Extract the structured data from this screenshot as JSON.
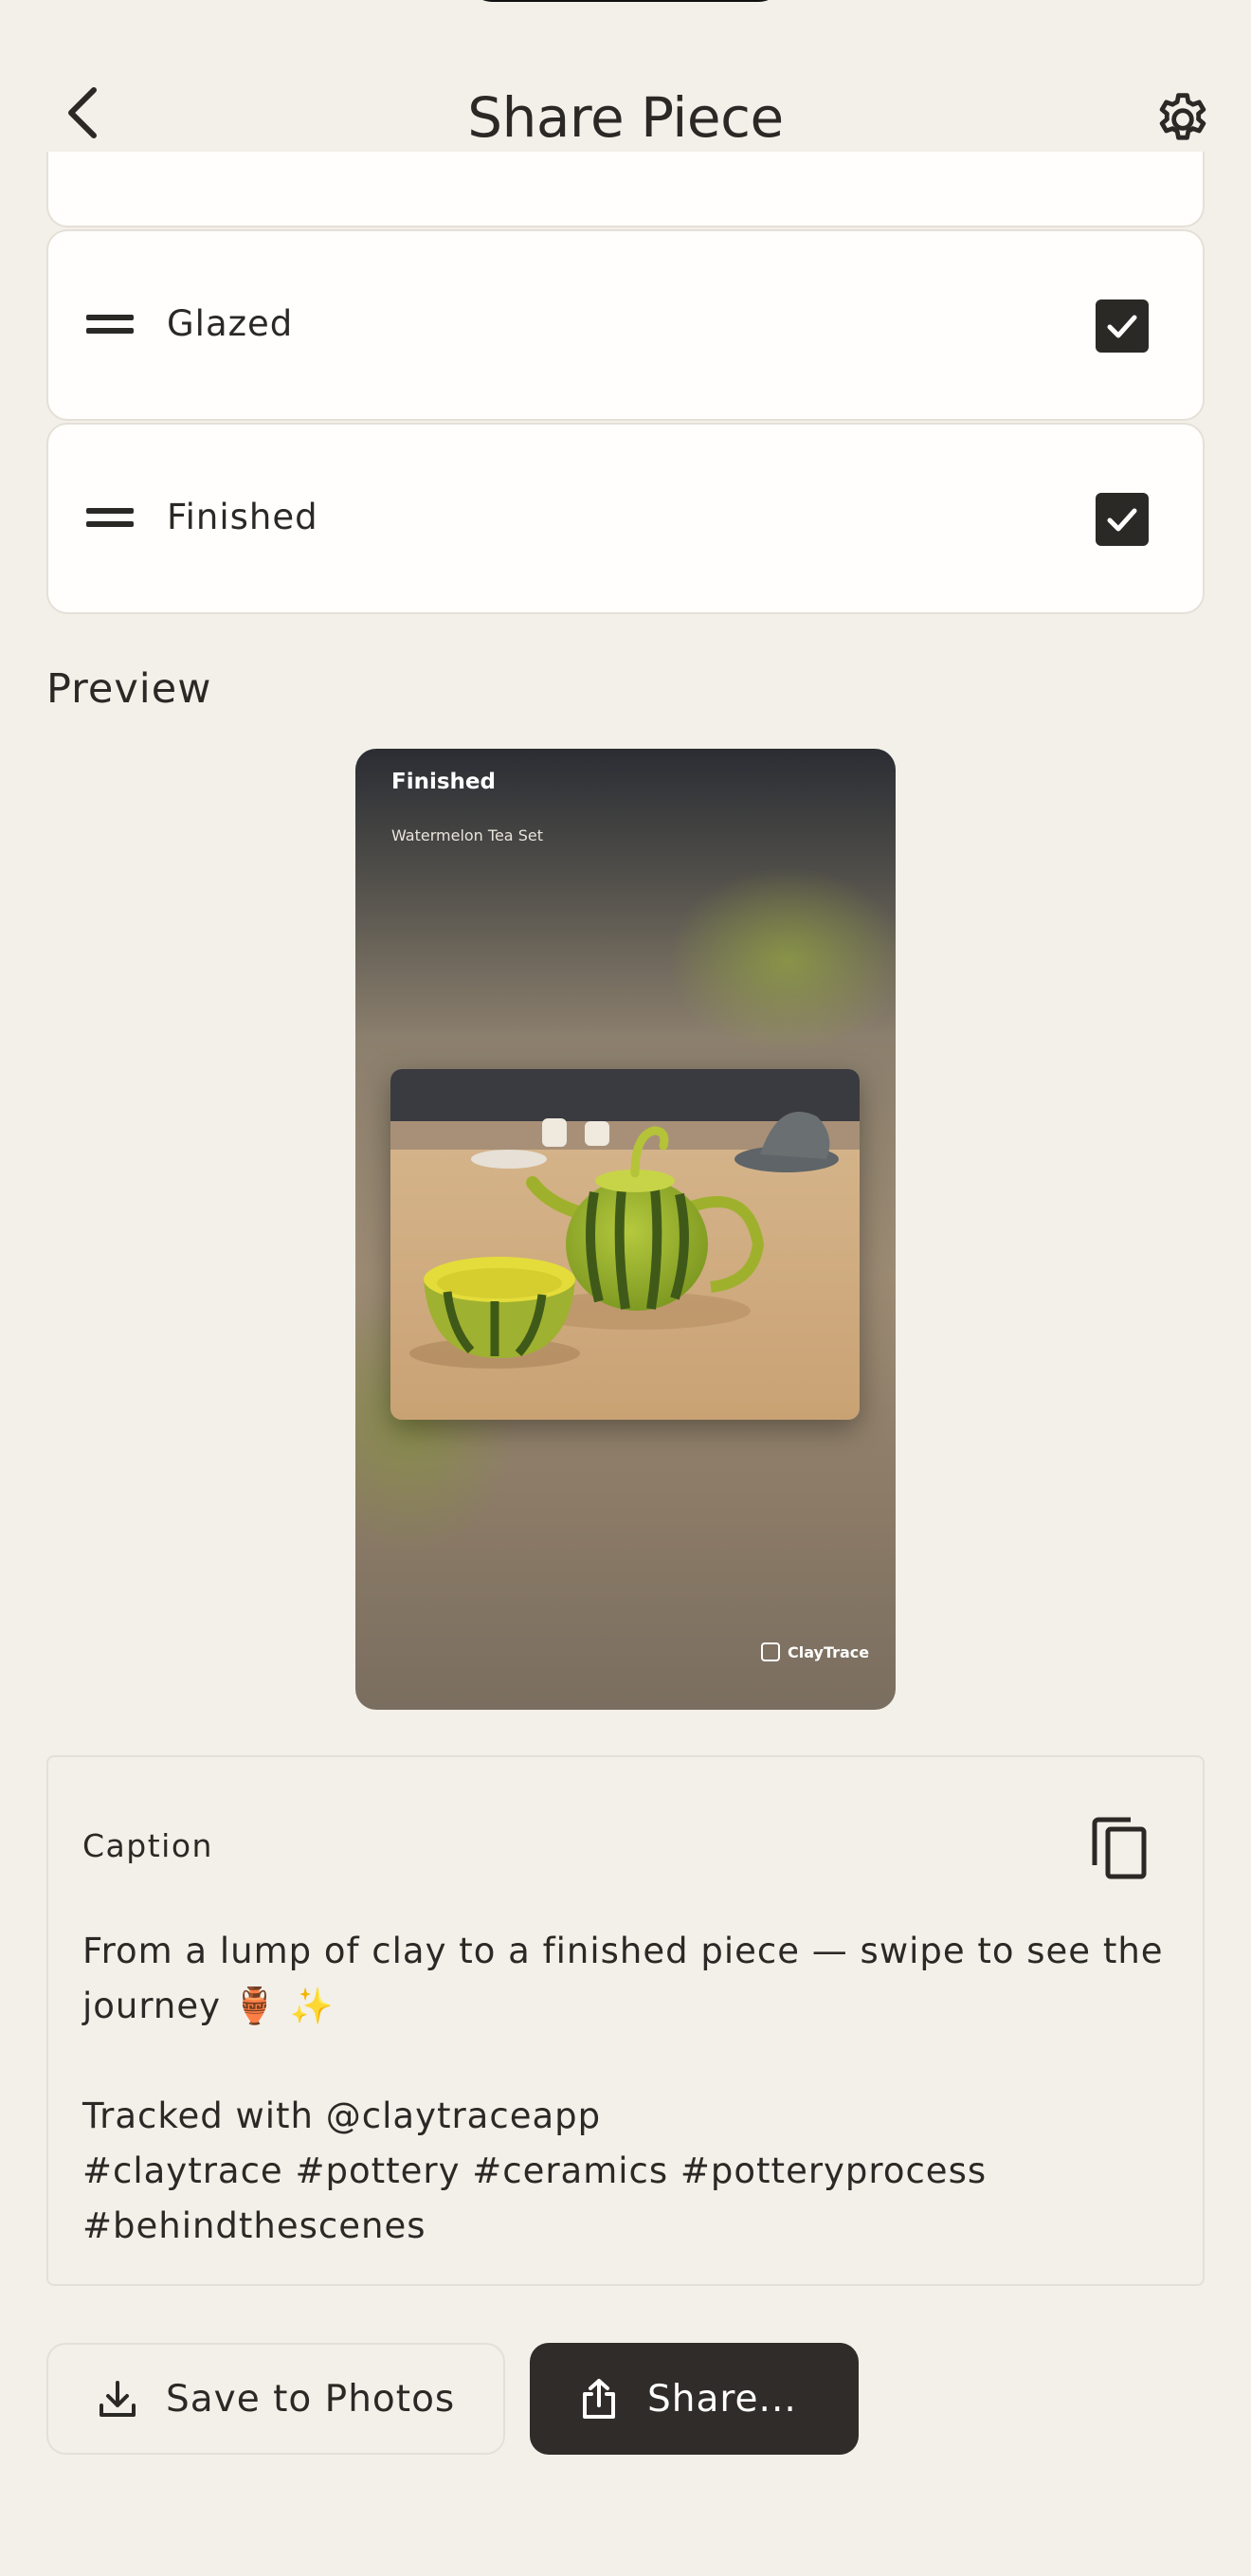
{
  "header": {
    "title": "Share Piece",
    "back_icon": "chevron-left-icon",
    "settings_icon": "gear-icon"
  },
  "stages": [
    {
      "label": "Glazed",
      "checked": true
    },
    {
      "label": "Finished",
      "checked": true
    }
  ],
  "preview": {
    "section_title": "Preview",
    "stage": "Finished",
    "piece_name": "Watermelon Tea Set",
    "brand": "ClayTrace"
  },
  "caption": {
    "label": "Caption",
    "text": "From a lump of clay to a finished piece — swipe to see the journey 🏺 ✨\n\nTracked with @claytraceapp\n#claytrace #pottery #ceramics #potteryprocess\n#behindthescenes"
  },
  "actions": {
    "save_label": "Save to Photos",
    "share_label": "Share..."
  },
  "colors": {
    "background": "#f3f0e9",
    "card": "#fffefc",
    "primary": "#2f2c29",
    "border": "#e4e0d8"
  }
}
